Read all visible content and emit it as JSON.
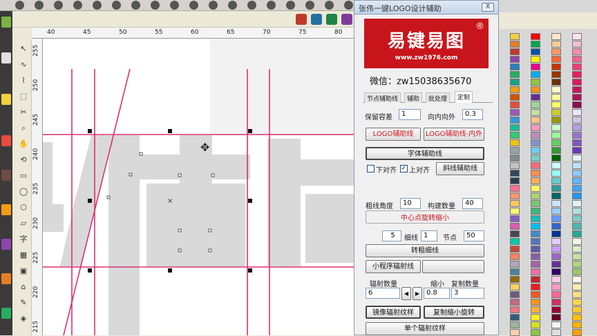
{
  "plugin": {
    "title": "张伟一键LOGO设计辅助",
    "close": "X",
    "logo_text": "易键易图",
    "logo_reg": "®",
    "logo_url": "www.zw1976.com",
    "wechat": "微信：zw15038635670",
    "tabs": [
      "节点辅助线",
      "辅助",
      "批处理",
      "定制"
    ],
    "tolerance_label": "保留容差",
    "tolerance_value": "1",
    "inout_label": "向内向外",
    "inout_value": "0.3",
    "logo_guide_btn": "LOGO辅助线",
    "logo_guide_inout_btn": "LOGO辅助线-内外",
    "font_guide_btn": "字体辅助线",
    "bottom_align_label": "下对齐",
    "top_align_label": "上对齐",
    "oblique_guide_btn": "斜线辅助线",
    "thick_angle_label": "粗线角度",
    "thick_angle_value": "10",
    "build_count_label": "构建数量",
    "build_count_value": "40",
    "center_rotate_label": "中心点旋转缩小",
    "thick_value": "5",
    "thin_label": "细线",
    "thin_value": "1",
    "node_label": "节点",
    "node_value": "50",
    "thick_thin_btn": "转粗细线",
    "mini_radial_btn": "小程序辐射线",
    "radial_count_label": "辐射数量",
    "shrink_label": "缩小",
    "copy_count_label": "复制数量",
    "radial_count_value": "6",
    "shrink_value": "0.8",
    "copy_count_value": "3",
    "mirror_radial_btn": "镜像辐射纹样",
    "copy_shrink_rotate_btn": "复制缩小旋转",
    "single_radial_btn": "单个辐射纹样"
  },
  "ruler_top": [
    "40",
    "45",
    "50",
    "55",
    "60",
    "65",
    "70",
    "75",
    "80"
  ],
  "ruler_left": [
    "255",
    "250",
    "245",
    "240",
    "235",
    "230",
    "225",
    "220",
    "215"
  ],
  "toolbox_glyphs": [
    "↖",
    "∿",
    "⌇",
    "⬚",
    "✂",
    "⌕",
    "✋",
    "⟲",
    "▭",
    "◯",
    "⬡",
    "▱",
    "字",
    "▦",
    "▣",
    "⌂",
    "✎",
    "◈"
  ],
  "colors": {
    "guide": "#d9306f",
    "glyph": "#d9d9d9",
    "logo_red": "#c8151c"
  }
}
